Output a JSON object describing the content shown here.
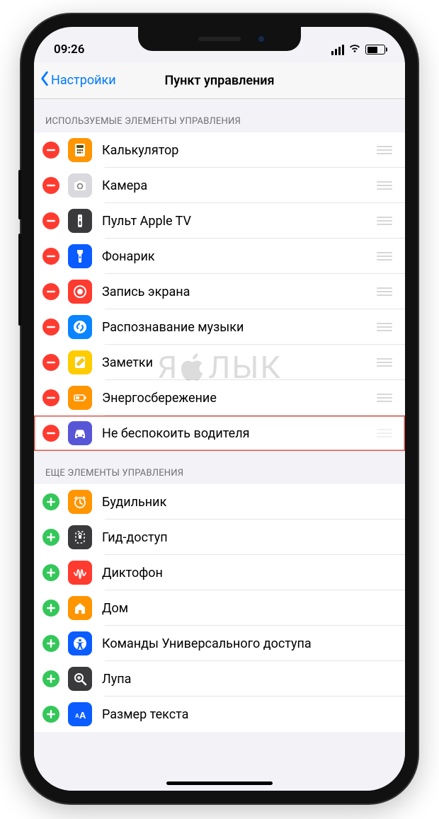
{
  "statusbar": {
    "time": "09:26"
  },
  "nav": {
    "back": "Настройки",
    "title": "Пункт управления"
  },
  "watermark": {
    "left": "Я",
    "right": "ЛЫК"
  },
  "sections": {
    "included": {
      "header": "ИСПОЛЬЗУЕМЫЕ ЭЛЕМЕНТЫ УПРАВЛЕНИЯ",
      "items": [
        {
          "label": "Калькулятор",
          "icon": "calculator",
          "bg": "#ff9500"
        },
        {
          "label": "Камера",
          "icon": "camera",
          "bg": "#d9d9de"
        },
        {
          "label": "Пульт Apple TV",
          "icon": "remote",
          "bg": "#3a3a3c"
        },
        {
          "label": "Фонарик",
          "icon": "flashlight",
          "bg": "#0a5cff"
        },
        {
          "label": "Запись экрана",
          "icon": "record",
          "bg": "#ff3b30"
        },
        {
          "label": "Распознавание музыки",
          "icon": "shazam",
          "bg": "#0a84ff"
        },
        {
          "label": "Заметки",
          "icon": "notes",
          "bg": "#ffcc00"
        },
        {
          "label": "Энергосбережение",
          "icon": "battery",
          "bg": "#ff9500"
        },
        {
          "label": "Не беспокоить водителя",
          "icon": "car",
          "bg": "#5856d6",
          "highlight": true,
          "faded_grip": true
        }
      ]
    },
    "more": {
      "header": "ЕЩЕ ЭЛЕМЕНТЫ УПРАВЛЕНИЯ",
      "items": [
        {
          "label": "Будильник",
          "icon": "alarm",
          "bg": "#ff9500"
        },
        {
          "label": "Гид-доступ",
          "icon": "guided",
          "bg": "#3a3a3c"
        },
        {
          "label": "Диктофон",
          "icon": "voice",
          "bg": "#ff3b30"
        },
        {
          "label": "Дом",
          "icon": "home",
          "bg": "#ff9500"
        },
        {
          "label": "Команды Универсального доступа",
          "icon": "access",
          "bg": "#0a5cff"
        },
        {
          "label": "Лупа",
          "icon": "magnify",
          "bg": "#3a3a3c"
        },
        {
          "label": "Размер текста",
          "icon": "textsize",
          "bg": "#0a5cff"
        }
      ]
    }
  }
}
